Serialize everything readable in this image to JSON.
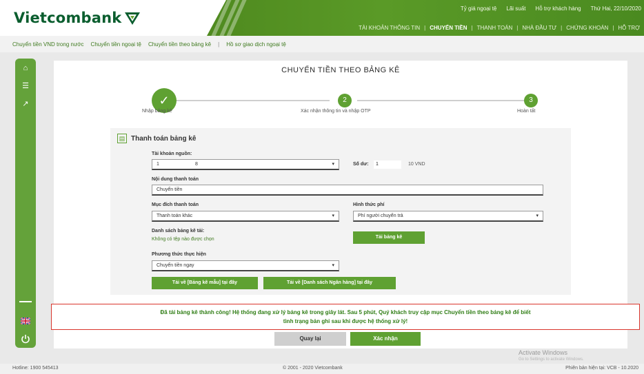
{
  "brand": {
    "name": "Vietcombank",
    "color": "#0a5d2e",
    "accent": "#5fa132"
  },
  "top_info": [
    "Tỷ giá ngoại tệ",
    "Lãi suất",
    "Hỗ trợ khách hàng",
    "Thứ Hai, 22/10/2020"
  ],
  "main_nav": [
    "TÀI KHOẢN THÔNG TIN",
    "CHUYỂN TIỀN",
    "THANH TOÁN",
    "NHÀ ĐẦU TƯ",
    "CHỨNG KHOÁN",
    "HỖ TRỢ"
  ],
  "subnav": [
    "Chuyển tiền VND trong nước",
    "Chuyển tiền ngoại tệ",
    "Chuyển tiền theo bảng kê",
    "Hồ sơ giao dịch ngoại tệ"
  ],
  "page_title": "CHUYỂN TIỀN THEO BẢNG KÊ",
  "steps": [
    {
      "label": "Nhập bảng kê",
      "mark": "✓"
    },
    {
      "label": "Xác nhận thông tin và nhập OTP",
      "mark": "2"
    },
    {
      "label": "Hoàn tất",
      "mark": "3"
    }
  ],
  "form": {
    "title": "Thanh toán bảng kê",
    "source_account_label": "Tài khoản nguồn:",
    "source_account_value": "1",
    "source_account_tail": "8",
    "balance_label": "Số dư:",
    "balance_value": "1",
    "balance_currency": "10 VND",
    "content_label": "Nội dung thanh toán",
    "content_value": "Chuyển tiền",
    "purpose_label": "Mục đích thanh toán",
    "purpose_value": "Thanh toán khác",
    "fee_label": "Hình thức phí",
    "fee_value": "Phí người chuyển trả",
    "list_label": "Danh sách bảng kê tải:",
    "list_note": "Không có tệp nào được chọn",
    "upload_button": "Tải bảng kê",
    "method_label": "Phương thức thực hiện",
    "method_value": "Chuyển tiền ngay",
    "template1_button": "Tải về [Bảng kê mẫu] tại đây",
    "template2_button": "Tải về [Danh sách Ngân hàng] tại đây"
  },
  "alert": {
    "line1": "Đã tải bảng kê thành công! Hệ thống đang xử lý bảng kê trong giây lát. Sau 5 phút, Quý khách truy cập mục Chuyển tiền theo bảng kê để biết",
    "line2": "tình trạng bản ghi sau khi được hệ thống xử lý!",
    "border_color": "#d9342b"
  },
  "actions": {
    "back": "Quay lại",
    "confirm": "Xác nhận"
  },
  "footer": {
    "hotline": "Hotline: 1900 545413",
    "copyright": "© 2001 - 2020 Vietcombank",
    "version": "Phiên bản hiện tại: VCB - 10.2020"
  },
  "watermark": {
    "title": "Activate Windows",
    "subtitle": "Go to Settings to activate Windows."
  }
}
